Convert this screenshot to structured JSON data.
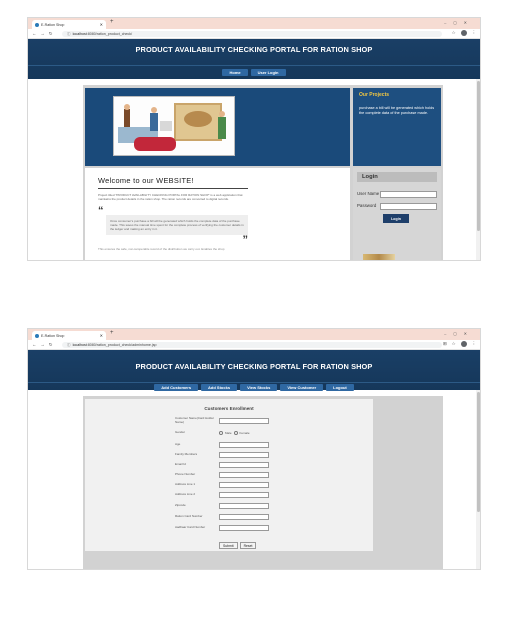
{
  "screen1": {
    "browser": {
      "tab_title": "E-Ration Shop",
      "url_host": "localhost",
      "url_path": ":8080/ration_product_check/"
    },
    "site_title": "PRODUCT AVAILABILITY CHECKING PORTAL FOR RATION SHOP",
    "menu": [
      "Home",
      "User Login"
    ],
    "projects": {
      "title": "Our Projects",
      "text": "purchase a bill will be generated which holds the complete data of the purchase made."
    },
    "welcome": {
      "title": "Welcome to our WEBSITE!",
      "paragraph": "Project titled \"PRODUCT AVAILABILITY CHECKING PORTAL FOR RATION SHOP\" is a web application that maintains the product details in the ration shop. The ration records are converted to digital records.",
      "quote": "Once consumer's purchase a bill will be generated which holds the complete data of the purchase made. This saves the manual time spent for the complete process of verifying the customer details in the ledger and making an entry in it.",
      "footer": "This ensures the safe, non-tamperable record of the distribution we carry out. Enables the shop"
    },
    "login": {
      "title": "Login",
      "user_label": "User Name",
      "password_label": "Password",
      "button": "Login"
    }
  },
  "screen2": {
    "browser": {
      "tab_title": "E-Ration Shop",
      "url_host": "localhost",
      "url_path": ":8080/ration_product_check/adminhome.jsp"
    },
    "site_title": "PRODUCT AVAILABILITY CHECKING PORTAL FOR RATION SHOP",
    "menu": [
      "Add Customers",
      "Add Stocks",
      "View Stocks",
      "View Customer",
      "Logout"
    ],
    "form": {
      "title": "Customers Enrollment",
      "fields": [
        {
          "label": "Customer Name(Card Holder Name)"
        },
        {
          "label": "Gender",
          "options": [
            "Male",
            "Female"
          ]
        },
        {
          "label": "Age"
        },
        {
          "label": "Family Members"
        },
        {
          "label": "Email Id"
        },
        {
          "label": "Phone Number"
        },
        {
          "label": "Address Line 1"
        },
        {
          "label": "Address Line 2"
        },
        {
          "label": "Zipcode"
        },
        {
          "label": "Ration Card Number"
        },
        {
          "label": "Aadhaar Card Number"
        }
      ],
      "submit": "Submit",
      "reset": "Reset"
    }
  }
}
